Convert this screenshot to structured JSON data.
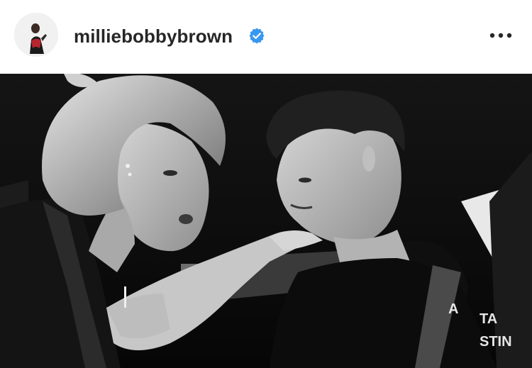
{
  "post": {
    "username": "milliebobbybrown",
    "verified": true,
    "verified_badge_color": "#3897f0",
    "more_icon": "more-horizontal-icon"
  },
  "photo": {
    "type": "grayscale-photo",
    "visible_text_fragments": [
      "A",
      "TA",
      "STIN"
    ]
  }
}
